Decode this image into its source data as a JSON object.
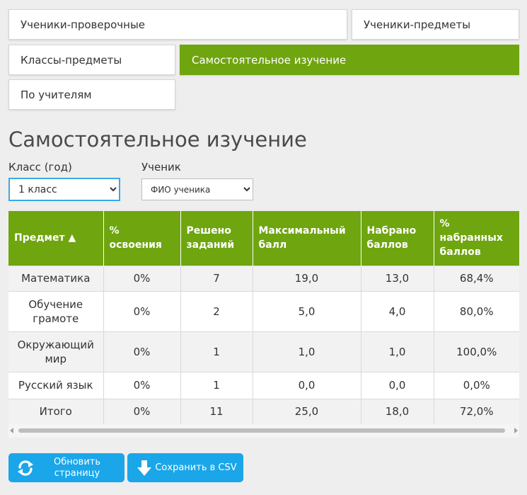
{
  "tabs": [
    {
      "label": "Ученики-проверочные"
    },
    {
      "label": "Ученики-предметы"
    },
    {
      "label": "Классы-предметы"
    },
    {
      "label": "Самостоятельное изучение"
    },
    {
      "label": "По учителям"
    }
  ],
  "page": {
    "title": "Самостоятельное изучение"
  },
  "filters": {
    "class_label": "Класс (год)",
    "class_value": "1 класс",
    "student_label": "Ученик",
    "student_placeholder": "ФИО ученика"
  },
  "table": {
    "headers": [
      "Предмет ▲",
      "% освоения",
      "Решено заданий",
      "Максимальный балл",
      "Набрано баллов",
      "% набранных баллов"
    ],
    "rows": [
      [
        "Математика",
        "0%",
        "7",
        "19,0",
        "13,0",
        "68,4%"
      ],
      [
        "Обучение грамоте",
        "0%",
        "2",
        "5,0",
        "4,0",
        "80,0%"
      ],
      [
        "Окружающий мир",
        "0%",
        "1",
        "1,0",
        "1,0",
        "100,0%"
      ],
      [
        "Русский язык",
        "0%",
        "1",
        "0,0",
        "0,0",
        "0,0%"
      ],
      [
        "Итого",
        "0%",
        "11",
        "25,0",
        "18,0",
        "72,0%"
      ]
    ]
  },
  "buttons": {
    "refresh_label": "Обновить страницу",
    "save_label": "Сохранить в CSV"
  },
  "icons": {
    "refresh": "refresh-icon",
    "download": "download-arrow-icon"
  },
  "colors": {
    "accent_green": "#6fa50f",
    "button_blue": "#1aa6e8",
    "focus_blue": "#3aa9e6"
  }
}
